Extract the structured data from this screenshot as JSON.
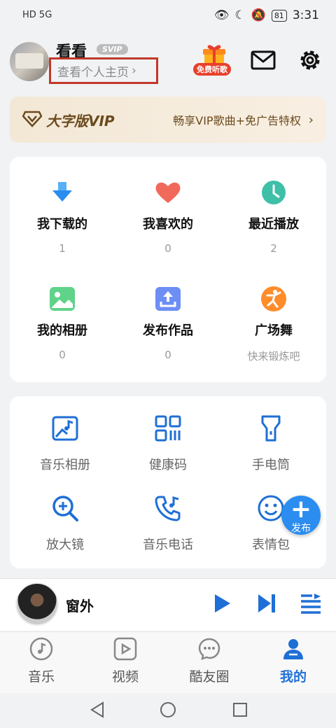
{
  "status_bar": {
    "left": "HD 5G",
    "battery": "81",
    "time": "3:31"
  },
  "header": {
    "username": "看看",
    "svip_badge": "SVIP",
    "profile_link": "查看个人主页",
    "gift_badge": "免费听歌"
  },
  "vip_banner": {
    "title": "大字版VIP",
    "desc": "畅享VIP歌曲+免广告特权"
  },
  "stats": [
    {
      "title": "我下载的",
      "value": "1",
      "icon": "download-icon"
    },
    {
      "title": "我喜欢的",
      "value": "0",
      "icon": "heart-icon"
    },
    {
      "title": "最近播放",
      "value": "2",
      "icon": "clock-icon"
    },
    {
      "title": "我的相册",
      "value": "0",
      "icon": "photo-icon"
    },
    {
      "title": "发布作品",
      "value": "0",
      "icon": "upload-icon"
    },
    {
      "title": "广场舞",
      "value": "快来锻炼吧",
      "icon": "dance-icon"
    }
  ],
  "tools": [
    {
      "label": "音乐相册",
      "icon": "music-album-icon"
    },
    {
      "label": "健康码",
      "icon": "qr-code-icon"
    },
    {
      "label": "手电筒",
      "icon": "flashlight-icon"
    },
    {
      "label": "放大镜",
      "icon": "magnifier-icon"
    },
    {
      "label": "音乐电话",
      "icon": "phone-music-icon"
    },
    {
      "label": "表情包",
      "icon": "emoji-icon"
    }
  ],
  "fab": {
    "label": "发布"
  },
  "player": {
    "song": "窗外"
  },
  "nav": [
    {
      "label": "音乐",
      "icon": "music-note-icon"
    },
    {
      "label": "视频",
      "icon": "video-icon"
    },
    {
      "label": "酷友圈",
      "icon": "chat-icon"
    },
    {
      "label": "我的",
      "icon": "user-icon"
    }
  ],
  "colors": {
    "accent": "#1f6fd6",
    "highlight_box": "#c0392b",
    "vip_text": "#6b4a1e"
  }
}
